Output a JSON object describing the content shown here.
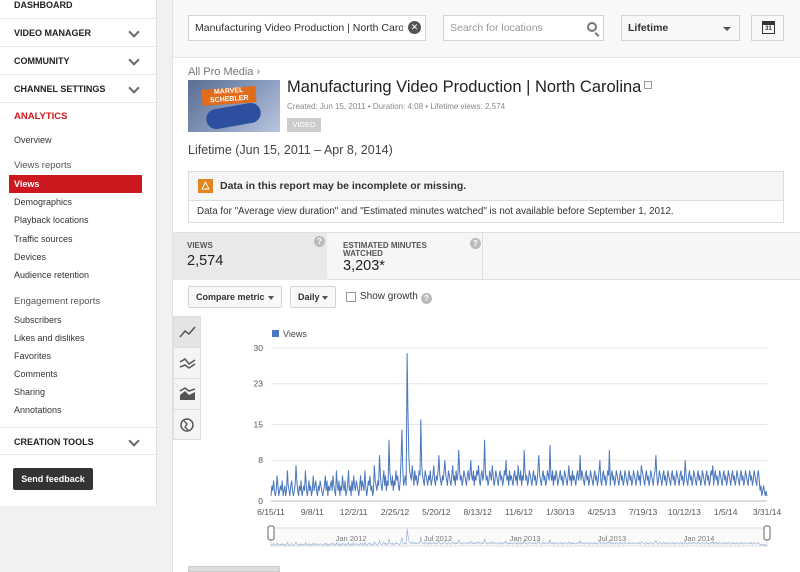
{
  "sidebar": {
    "sections": [
      {
        "label": "Dashboard",
        "has_chevron": false
      },
      {
        "label": "Video Manager",
        "has_chevron": true
      },
      {
        "label": "Community",
        "has_chevron": true
      },
      {
        "label": "Channel Settings",
        "has_chevron": true
      }
    ],
    "analytics_label": "ANALYTICS",
    "overview": "Overview",
    "views_reports_heading": "Views reports",
    "views_items": [
      "Views",
      "Demographics",
      "Playback locations",
      "Traffic sources",
      "Devices",
      "Audience retention"
    ],
    "engagement_heading": "Engagement reports",
    "engagement_items": [
      "Subscribers",
      "Likes and dislikes",
      "Favorites",
      "Comments",
      "Sharing",
      "Annotations"
    ],
    "creation_tools": "Creation Tools",
    "feedback_button": "Send feedback"
  },
  "topbar": {
    "content_field_value": "Manufacturing Video Production | North Carolina",
    "search_placeholder": "Search for locations",
    "date_range": "Lifetime",
    "calendar_day": "31"
  },
  "video": {
    "breadcrumb": "All Pro Media ›",
    "thumbnail_text": "MARVEL SCHEBLER",
    "title": "Manufacturing Video Production | North Carolina",
    "meta": "Created: Jun 15, 2011  •  Duration: 4:08  •  Lifetime views: 2,574",
    "badge": "VIDEO"
  },
  "period_label": "Lifetime (Jun 15, 2011 – Apr 8, 2014)",
  "warning": {
    "icon": "△",
    "title": "Data in this report may be incomplete or missing.",
    "body": "Data for \"Average view duration\" and \"Estimated minutes watched\" is not available before September 1, 2012."
  },
  "metrics": [
    {
      "label": "Views",
      "value": "2,574"
    },
    {
      "label": "Estimated minutes watched",
      "value": "3,203*"
    }
  ],
  "controls": {
    "compare_metric": "Compare metric",
    "granularity": "Daily",
    "show_growth": "Show growth"
  },
  "icons": {
    "tools": [
      "line-chart-icon",
      "multi-line-chart-icon",
      "stacked-area-chart-icon",
      "globe-map-icon"
    ],
    "help": "question-mark-icon"
  },
  "colors": {
    "accent_red": "#cc181e",
    "series_blue": "#4a77bd",
    "warning_orange": "#e28521"
  },
  "chart_data": {
    "type": "line",
    "series": [
      {
        "name": "Views",
        "color": "#4a77bd"
      }
    ],
    "x_start": "6/15/11",
    "x_end": "3/31/14",
    "x_ticks": [
      "6/15/11",
      "9/8/11",
      "12/2/11",
      "2/25/12",
      "5/20/12",
      "8/13/12",
      "11/6/12",
      "1/30/13",
      "4/25/13",
      "7/19/13",
      "10/12/13",
      "1/5/14",
      "3/31/14"
    ],
    "y_ticks": [
      0,
      8,
      15,
      23,
      30
    ],
    "ylim": [
      0,
      30
    ],
    "navigator_labels": [
      "Jan 2012",
      "Jul 2012",
      "Jan 2013",
      "Jul 2013",
      "Jan 2014"
    ],
    "daily_values": [
      1,
      3,
      2,
      4,
      2,
      1,
      2,
      5,
      3,
      1,
      2,
      3,
      2,
      4,
      1,
      2,
      3,
      1,
      2,
      6,
      3,
      2,
      1,
      3,
      4,
      2,
      1,
      2,
      3,
      7,
      4,
      2,
      1,
      3,
      2,
      4,
      1,
      2,
      3,
      2,
      6,
      3,
      1,
      2,
      4,
      2,
      3,
      1,
      2,
      5,
      2,
      3,
      4,
      2,
      1,
      3,
      2,
      4,
      3,
      2,
      1,
      2,
      3,
      5,
      2,
      4,
      1,
      3,
      2,
      3,
      4,
      2,
      5,
      3,
      2,
      1,
      6,
      3,
      2,
      4,
      1,
      3,
      2,
      5,
      3,
      2,
      4,
      1,
      2,
      3,
      6,
      2,
      3,
      1,
      4,
      2,
      5,
      3,
      2,
      4,
      3,
      2,
      1,
      3,
      5,
      2,
      4,
      3,
      2,
      6,
      3,
      1,
      2,
      4,
      3,
      5,
      2,
      3,
      1,
      2,
      7,
      4,
      3,
      2,
      4,
      3,
      9,
      5,
      3,
      2,
      4,
      6,
      3,
      5,
      2,
      4,
      3,
      12,
      6,
      4,
      3,
      5,
      2,
      4,
      3,
      6,
      4,
      5,
      3,
      2,
      4,
      8,
      14,
      6,
      3,
      4,
      5,
      3,
      29,
      18,
      9,
      6,
      5,
      4,
      7,
      5,
      3,
      6,
      4,
      5,
      3,
      4,
      6,
      5,
      16,
      7,
      5,
      4,
      3,
      6,
      5,
      4,
      3,
      5,
      4,
      6,
      3,
      4,
      5,
      7,
      4,
      3,
      5,
      4,
      6,
      9,
      5,
      4,
      3,
      5,
      4,
      6,
      8,
      5,
      4,
      3,
      6,
      5,
      4,
      3,
      5,
      7,
      4,
      5,
      3,
      6,
      4,
      5,
      10,
      6,
      4,
      5,
      3,
      4,
      6,
      5,
      4,
      3,
      5,
      6,
      4,
      5,
      8,
      5,
      4,
      6,
      3,
      5,
      4,
      6,
      5,
      7,
      4,
      3,
      5,
      6,
      4,
      5,
      12,
      6,
      4,
      5,
      3,
      4,
      6,
      5,
      4,
      7,
      5,
      3,
      4,
      6,
      5,
      4,
      3,
      5,
      6,
      4,
      5,
      3,
      4,
      6,
      5,
      8,
      4,
      5,
      3,
      6,
      4,
      5,
      4,
      3,
      5,
      6,
      4,
      5,
      3,
      7,
      5,
      4,
      6,
      3,
      5,
      4,
      10,
      6,
      4,
      5,
      3,
      4,
      6,
      5,
      4,
      3,
      5,
      6,
      4,
      5,
      3,
      4,
      6,
      9,
      5,
      4,
      3,
      5,
      6,
      4,
      5,
      3,
      4,
      6,
      5,
      4,
      11,
      5,
      4,
      6,
      3,
      5,
      4,
      6,
      5,
      3,
      4,
      5,
      6,
      4,
      5,
      3,
      4,
      6,
      5,
      4,
      3,
      5,
      7,
      4,
      5,
      3,
      6,
      4,
      5,
      4,
      3,
      5,
      6,
      4,
      5,
      9,
      4,
      6,
      5,
      4,
      3,
      5,
      6,
      4,
      5,
      3,
      4,
      6,
      5,
      4,
      3,
      5,
      6,
      4,
      5,
      3,
      4,
      6,
      8,
      4,
      3,
      5,
      6,
      4,
      5,
      3,
      4,
      6,
      5,
      10,
      3,
      5,
      6,
      4,
      5,
      3,
      4,
      6,
      5,
      4,
      3,
      5,
      6,
      4,
      5,
      3,
      4,
      6,
      5,
      4,
      3,
      5,
      6,
      4,
      5,
      3,
      4,
      6,
      5,
      4,
      3,
      5,
      6,
      4,
      5,
      3,
      7,
      6,
      5,
      4,
      3,
      5,
      6,
      4,
      5,
      3,
      4,
      6,
      5,
      4,
      3,
      5,
      6,
      9,
      5,
      3,
      4,
      6,
      5,
      4,
      3,
      5,
      6,
      4,
      5,
      3,
      4,
      6,
      5,
      4,
      3,
      5,
      6,
      4,
      5,
      3,
      4,
      6,
      5,
      4,
      3,
      5,
      6,
      4,
      5,
      3,
      4,
      8,
      5,
      4,
      3,
      5,
      6,
      4,
      5,
      3,
      4,
      6,
      5,
      4,
      3,
      5,
      6,
      4,
      5,
      3,
      4,
      6,
      5,
      4,
      3,
      5,
      6,
      4,
      5,
      3,
      4,
      6,
      5,
      7,
      3,
      5,
      6,
      4,
      5,
      3,
      4,
      6,
      5,
      4,
      3,
      5,
      6,
      4,
      5,
      3,
      4,
      6,
      5,
      4,
      3,
      5,
      6,
      4,
      5,
      3,
      4,
      6,
      5,
      4,
      3,
      5,
      6,
      4,
      5,
      3,
      4,
      6,
      5,
      4,
      3,
      5,
      6,
      4,
      5,
      3,
      4,
      6,
      5,
      4,
      3,
      5,
      6,
      4,
      2,
      3,
      1,
      2,
      3,
      2,
      1,
      2,
      1
    ]
  }
}
